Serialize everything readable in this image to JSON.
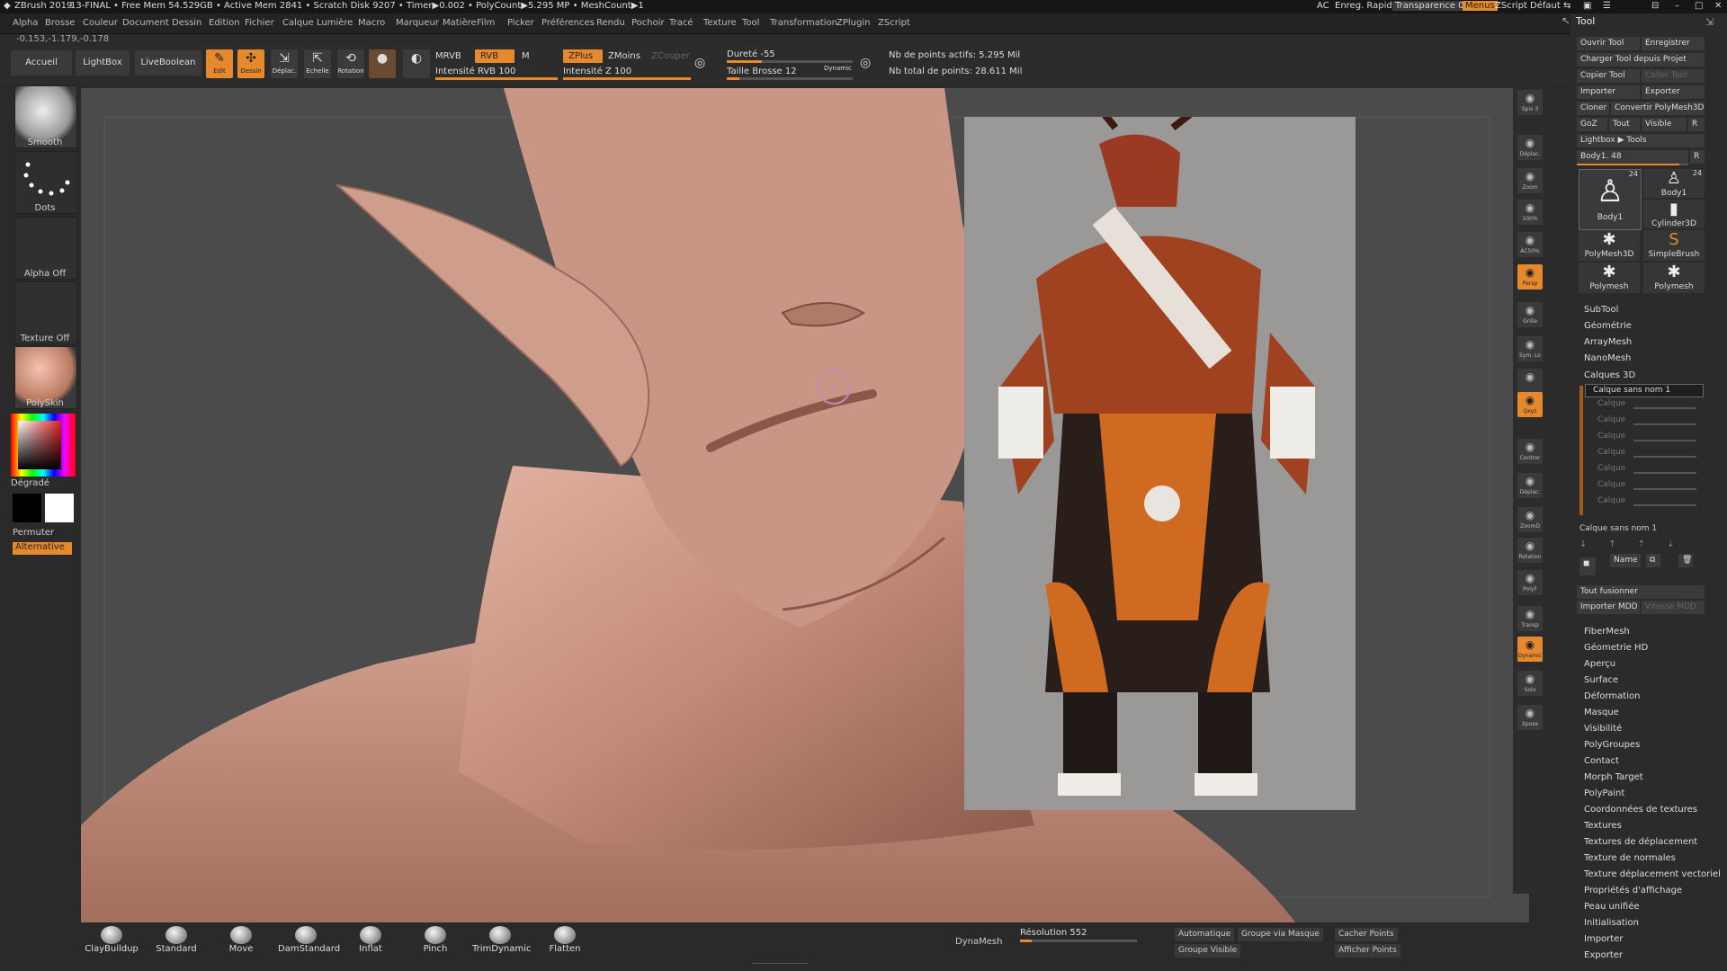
{
  "titlebar": {
    "app": "ZBrush 2019",
    "doc": "13-FINAL",
    "stats": "• Free Mem 54.529GB • Active Mem 2841 • Scratch Disk 9207 • Timer▶0.002 • PolyCount▶5.295 MP • MeshCount▶1",
    "ac": "AC",
    "quicksave": "Enreg. Rapide",
    "transparence": "Transparence 0",
    "menus": "Menus",
    "zscript_default": "ZScript Défaut"
  },
  "menu": [
    "Alpha",
    "Brosse",
    "Couleur",
    "Document",
    "Dessin",
    "Edition",
    "Fichier",
    "Calque",
    "Lumière",
    "Macro",
    "Marqueur",
    "Matière",
    "Film",
    "Picker",
    "Préférences",
    "Rendu",
    "Pochoir",
    "Tracé",
    "Texture",
    "Tool",
    "Transformation",
    "ZPlugin",
    "ZScript"
  ],
  "coords": "-0.153,-1.179,-0.178",
  "toolbar": {
    "home": "Accueil",
    "lightbox": "LightBox",
    "liveboolean": "LiveBoolean",
    "edit": "Edit",
    "draw": "Dessin",
    "move": "Déplac.",
    "scale": "Echelle",
    "rotate": "Rotation",
    "mrgb": "MRVB",
    "rgb": "RVB",
    "m": "M",
    "rgb_intensity": "Intensité RVB 100",
    "rgb_intensity_value": 100,
    "zadd": "ZPlus",
    "zsub": "ZMoins",
    "zcut": "ZCouper",
    "z_intensity": "Intensité Z 100",
    "z_intensity_value": 100,
    "focal_shift": "Dureté -55",
    "draw_size": "Taille Brosse 12",
    "dynamic": "Dynamic",
    "active_points": "Nb de points actifs: 5.295 Mil",
    "total_points": "Nb total de points: 28.611 Mil"
  },
  "leftshelf": {
    "smooth": "Smooth",
    "dots": "Dots",
    "alpha": "Alpha Off",
    "texture": "Texture Off",
    "material": "PolySkin",
    "gradient": "Dégradé",
    "swap": "Permuter",
    "alternate": "Alternative"
  },
  "rightstrip": [
    {
      "label": "Spix 3",
      "icon": "sphere-icon",
      "on": false
    },
    {
      "label": "Déplac.",
      "icon": "move-view-icon",
      "on": false
    },
    {
      "label": "Zoom",
      "icon": "zoom-icon",
      "on": false
    },
    {
      "label": "100%",
      "icon": "actual-size-icon",
      "on": false
    },
    {
      "label": "AC50%",
      "icon": "half-size-icon",
      "on": false
    },
    {
      "label": "Persp",
      "icon": "perspective-icon",
      "on": true
    },
    {
      "label": "Grille",
      "icon": "floor-grid-icon",
      "on": false
    },
    {
      "label": "Sym. Lo",
      "icon": "local-symmetry-icon",
      "on": false
    },
    {
      "label": "",
      "icon": "lock-icon",
      "on": false
    },
    {
      "label": "Qxyz",
      "icon": "axis-icon",
      "on": true
    },
    {
      "label": "Centrer",
      "icon": "frame-icon",
      "on": false
    },
    {
      "label": "Déplac.",
      "icon": "move-icon",
      "on": false
    },
    {
      "label": "ZoomD",
      "icon": "zoom3d-icon",
      "on": false
    },
    {
      "label": "Rotation",
      "icon": "rotate-icon",
      "on": false
    },
    {
      "label": "PolyF",
      "icon": "polyframe-icon",
      "on": false
    },
    {
      "label": "Transp",
      "icon": "transparency-icon",
      "on": false
    },
    {
      "label": "Dynamic",
      "icon": "ghost-icon",
      "on": true
    },
    {
      "label": "Solo",
      "icon": "solo-icon",
      "on": false
    },
    {
      "label": "Xpose",
      "icon": "explode-icon",
      "on": false
    }
  ],
  "toolpanel": {
    "title": "Tool",
    "load": "Ouvrir Tool",
    "save": "Enregistrer",
    "load_from_project": "Charger Tool depuis Projet",
    "copy": "Copier Tool",
    "paste": "Coller Tool",
    "import": "Importer",
    "export": "Exporter",
    "clone": "Cloner",
    "make_polymesh": "Convertir PolyMesh3D",
    "goz": "GoZ",
    "all": "Tout",
    "visible": "Visible",
    "r": "R",
    "lightbox_tools": "Lightbox ▶ Tools",
    "current_tool": "Body1. 48",
    "thumbs": [
      {
        "name": "Body1",
        "count": "24",
        "icon": "figure-icon"
      },
      {
        "name": "Body1",
        "count": "24",
        "icon": "figure-small-icon"
      },
      {
        "name": "Cylinder3D",
        "count": "",
        "icon": "cylinder-icon"
      },
      {
        "name": "PolyMesh3D",
        "count": "",
        "icon": "star-icon"
      },
      {
        "name": "SimpleBrush",
        "count": "",
        "icon": "brush-s-icon"
      },
      {
        "name": "Polymesh",
        "count": "",
        "icon": "star-icon"
      },
      {
        "name": "Polymesh",
        "count": "",
        "icon": "star-icon"
      }
    ],
    "sections_top": [
      "SubTool",
      "Géométrie",
      "ArrayMesh",
      "NanoMesh",
      "Calques 3D"
    ],
    "layer_name": "Calque sans nom 1",
    "layer_rows": [
      "Calque",
      "Calque",
      "Calque",
      "Calque",
      "Calque",
      "Calque",
      "Calque"
    ],
    "layer_name2": "Calque sans nom 1",
    "layer_name_btn": "Name",
    "bake_all": "Tout fusionner",
    "import_mdd": "Importer MDD",
    "mdd_speed": "Vitesse MDD",
    "sections": [
      "FiberMesh",
      "Géometrie HD",
      "Aperçu",
      "Surface",
      "Déformation",
      "Masque",
      "Visibilité",
      "PolyGroupes",
      "Contact",
      "Morph Target",
      "PolyPaint",
      "Coordonnées de textures",
      "Textures",
      "Textures de déplacement",
      "Texture de normales",
      "Texture déplacement vectoriel",
      "Propriétés d'affichage",
      "Peau unifiée",
      "Initialisation",
      "Importer",
      "Exporter"
    ]
  },
  "brushes": [
    "ClayBuildup",
    "Standard",
    "Move",
    "DamStandard",
    "Inflat",
    "Pinch",
    "TrimDynamic",
    "Flatten"
  ],
  "bottom": {
    "dynamesh": "DynaMesh",
    "resolution": "Résolution 552",
    "resolution_value": 552,
    "auto": "Automatique",
    "group_by_mask": "Groupe via Masque",
    "hide_points": "Cacher Points",
    "group_visible": "Groupe Visible",
    "show_points": "Afficher Points"
  },
  "colors": {
    "accent": "#e5892c",
    "skin": "#c99686",
    "bg_panel": "#2b2b2b",
    "canvas": "#4a4a4a"
  }
}
